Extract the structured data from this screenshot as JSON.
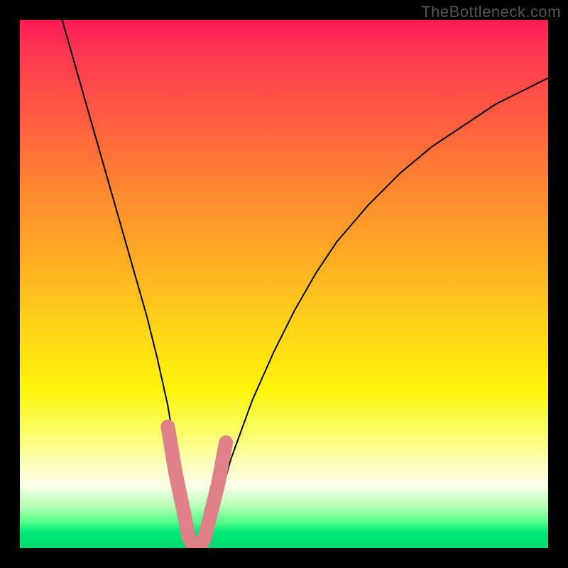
{
  "watermark": "TheBottleneck.com",
  "chart_data": {
    "type": "line",
    "title": "",
    "xlabel": "",
    "ylabel": "",
    "xlim": [
      0,
      100
    ],
    "ylim": [
      0,
      100
    ],
    "series": [
      {
        "name": "bottleneck-curve",
        "x": [
          8,
          10,
          12,
          14,
          16,
          18,
          20,
          22,
          24,
          26,
          28,
          29,
          30,
          31,
          32,
          33,
          34,
          35,
          36,
          38,
          40,
          44,
          48,
          52,
          56,
          60,
          66,
          72,
          78,
          84,
          90,
          96,
          100
        ],
        "y": [
          100,
          93,
          86,
          79,
          72,
          65,
          58,
          51,
          44,
          36,
          27,
          21,
          14,
          8,
          3,
          0,
          0,
          0,
          3,
          10,
          17,
          28,
          37,
          45,
          52,
          58,
          65,
          71,
          76,
          80,
          84,
          87,
          89
        ]
      }
    ],
    "highlight": {
      "name": "optimal-zone",
      "color": "#e0818a",
      "x": [
        28,
        29.5,
        31,
        32,
        33,
        34,
        35,
        36,
        37.5,
        39
      ],
      "y": [
        23,
        14,
        7,
        2,
        0,
        0,
        2,
        6,
        12,
        20
      ]
    },
    "gradient_stops": [
      {
        "pos": 0,
        "color": "#ff1a55"
      },
      {
        "pos": 50,
        "color": "#ffc81e"
      },
      {
        "pos": 78,
        "color": "#fcff70"
      },
      {
        "pos": 95,
        "color": "#55ff88"
      },
      {
        "pos": 100,
        "color": "#00d870"
      }
    ]
  }
}
